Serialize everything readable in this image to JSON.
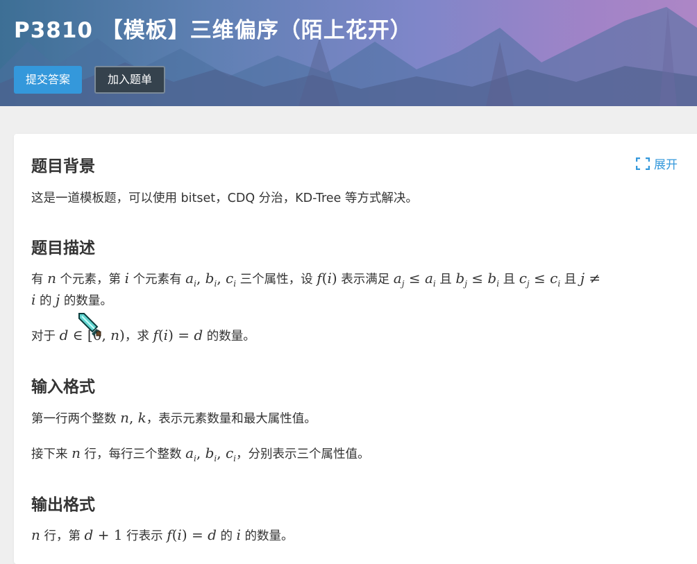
{
  "header": {
    "title": "P3810 【模板】三维偏序（陌上花开）",
    "submit_label": "提交答案",
    "add_list_label": "加入题单"
  },
  "toolbar": {
    "expand_label": "展开"
  },
  "sections": {
    "background": {
      "heading": "题目背景",
      "text": "这是一道模板题，可以使用 bitset，CDQ 分治，KD-Tree 等方式解决。"
    },
    "description": {
      "heading": "题目描述",
      "l1_a": "有 ",
      "l1_n": "n",
      "l1_b": " 个元素，第 ",
      "l1_i": "i",
      "l1_c": " 个元素有 ",
      "l1_d": " 三个属性，设 ",
      "l1_e": " 表示满足 ",
      "l1_and1": " 且 ",
      "l1_and2": " 且 ",
      "l1_and3": " 且 ",
      "l2_i": "i",
      "l2_a": " 的 ",
      "l2_j": "j",
      "l2_b": " 的数量。",
      "l3_a": "对于 ",
      "l3_b": "，求 ",
      "l3_c": " 的数量。"
    },
    "input": {
      "heading": "输入格式",
      "l1_a": "第一行两个整数 ",
      "l1_b": "，表示元素数量和最大属性值。",
      "l2_a": "接下来 ",
      "l2_n": "n",
      "l2_b": " 行，每行三个整数 ",
      "l2_c": "，分别表示三个属性值。"
    },
    "output": {
      "heading": "输出格式",
      "l1_n": "n",
      "l1_a": " 行，第 ",
      "l1_b": " 行表示 ",
      "l1_c": " 的 ",
      "l1_i": "i",
      "l1_d": " 的数量。"
    }
  },
  "colors": {
    "accent": "#3498db",
    "dark_button": "#35424d",
    "banner_start": "#3d6f95",
    "banner_end": "#ad86c6"
  },
  "icons": {
    "expand": "expand-corners-icon",
    "cursor": "diamond-sword-cursor-icon"
  }
}
